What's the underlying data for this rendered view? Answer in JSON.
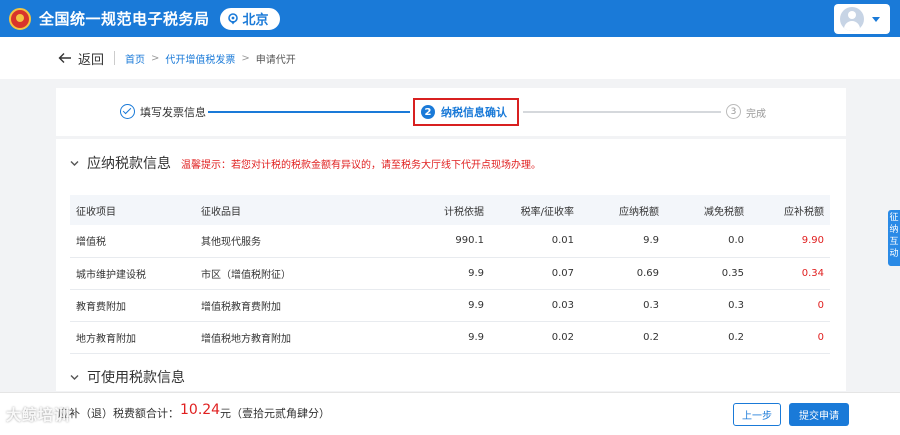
{
  "header": {
    "site_title": "全国统一规范电子税务局",
    "location": "北京",
    "colors": {
      "primary": "#1a7ad8",
      "alert": "#e02020"
    }
  },
  "breadcrumb": {
    "back_label": "返回",
    "items": [
      "首页",
      "代开增值税发票",
      "申请代开"
    ],
    "separator": ">"
  },
  "steps": [
    {
      "label": "填写发票信息",
      "state": "done"
    },
    {
      "number": "2",
      "label": "纳税信息确认",
      "state": "active"
    },
    {
      "number": "3",
      "label": "完成",
      "state": "pending"
    }
  ],
  "section_payable": {
    "title": "应纳税款信息",
    "notice": "温馨提示：若您对计税的税款金额有异议的，请至税务大厅线下代开点现场办理。"
  },
  "table": {
    "headers": [
      "征收项目",
      "征收品目",
      "计税依据",
      "税率/征收率",
      "应纳税额",
      "减免税额",
      "应补税额"
    ],
    "rows": [
      [
        "增值税",
        "其他现代服务",
        "990.1",
        "0.01",
        "9.9",
        "0.0",
        "9.90"
      ],
      [
        "城市维护建设税",
        "市区（增值税附征）",
        "9.9",
        "0.07",
        "0.69",
        "0.35",
        "0.34"
      ],
      [
        "教育费附加",
        "增值税教育费附加",
        "9.9",
        "0.03",
        "0.3",
        "0.3",
        "0"
      ],
      [
        "地方教育附加",
        "增值税地方教育附加",
        "9.9",
        "0.02",
        "0.2",
        "0.2",
        "0"
      ]
    ]
  },
  "section_available": {
    "title": "可使用税款信息"
  },
  "float_tab": {
    "label": "征纳互动"
  },
  "footer": {
    "label": "应补（退）税费额合计：",
    "amount": "10.24",
    "unit_text": "元（壹拾元贰角肆分）",
    "prev_button": "上一步",
    "submit_button": "提交申请"
  },
  "watermark": "大鲸培训"
}
